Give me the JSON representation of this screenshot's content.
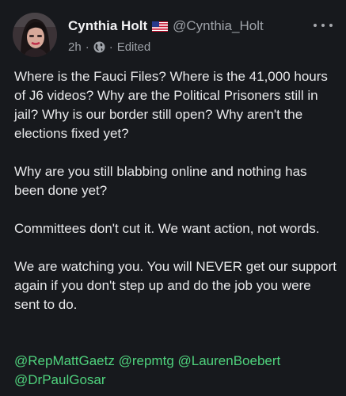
{
  "post": {
    "author": {
      "display_name": "Cynthia Holt",
      "handle": "@Cynthia_Holt",
      "flag_icon": "us-flag-icon",
      "avatar_icon": "profile-photo"
    },
    "meta": {
      "time": "2h",
      "separator": "·",
      "visibility_icon": "globe-icon",
      "edited": "Edited"
    },
    "more_icon": "more-options-icon",
    "paragraphs": [
      "Where is the Fauci Files? Where is the 41,000 hours of J6 videos? Why are the Political Prisoners still in jail? Why is our border still open? Why aren't the elections fixed yet?",
      "Why are you still blabbing online and nothing has been done yet?",
      "Committees don't cut it. We want action, not words.",
      "We are watching you. You will NEVER get our support again if you don't step up and do the job you were sent to do."
    ],
    "mentions": [
      "@RepMattGaetz",
      "@repmtg",
      "@LaurenBoebert",
      "@DrPaulGosar"
    ],
    "colors": {
      "background": "#17191d",
      "text": "#e8e8ea",
      "muted": "#9ea2a8",
      "mention": "#4fd27d"
    }
  }
}
